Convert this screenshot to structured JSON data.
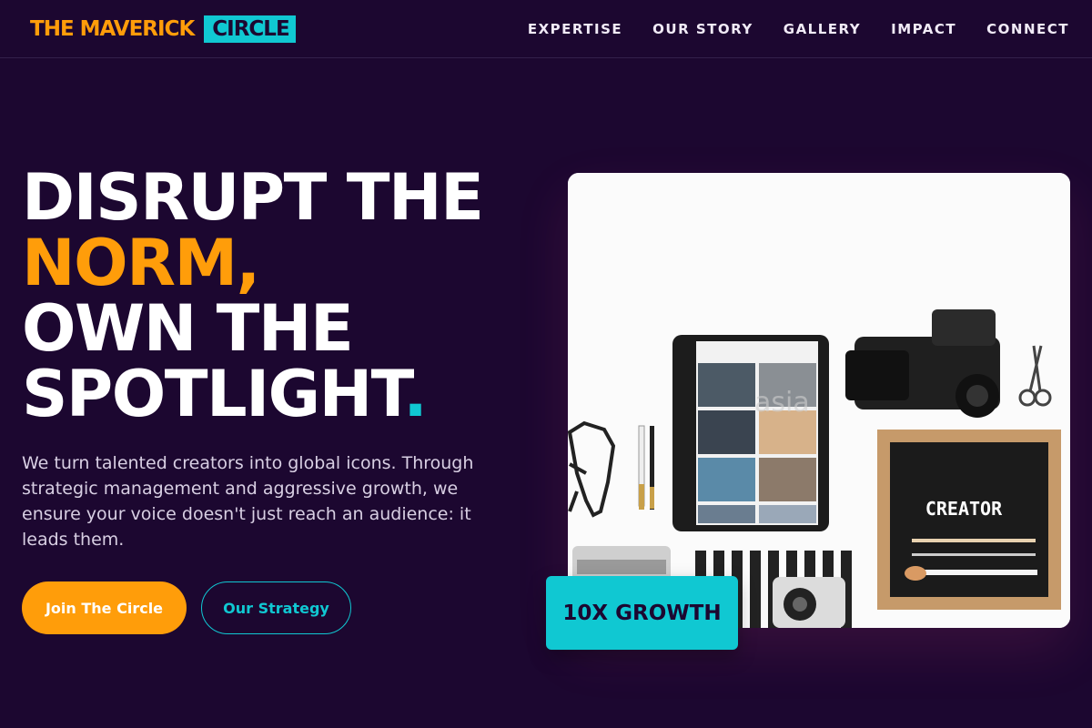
{
  "brand": {
    "name_main": "THE MAVERICK",
    "name_box": "CIRCLE"
  },
  "nav": {
    "links": [
      "EXPERTISE",
      "OUR STORY",
      "GALLERY",
      "IMPACT",
      "CONNECT"
    ]
  },
  "hero": {
    "title_line1": "DISRUPT THE",
    "title_line2": "NORM,",
    "title_line3": "OWN THE",
    "title_line4": "SPOTLIGHT",
    "title_dot": ".",
    "description": "We turn talented creators into global icons. Through strategic management and aggressive growth, we ensure your voice doesn't just reach an audience: it leads them.",
    "primary_button": "Join The Circle",
    "secondary_button": "Our Strategy"
  },
  "image": {
    "letterboard_text": "CREATOR",
    "watermark": "asia"
  },
  "badge": {
    "text": "10X GROWTH"
  },
  "colors": {
    "background": "#1c0730",
    "accent_orange": "#ff9d0a",
    "accent_cyan": "#10c8d2"
  }
}
